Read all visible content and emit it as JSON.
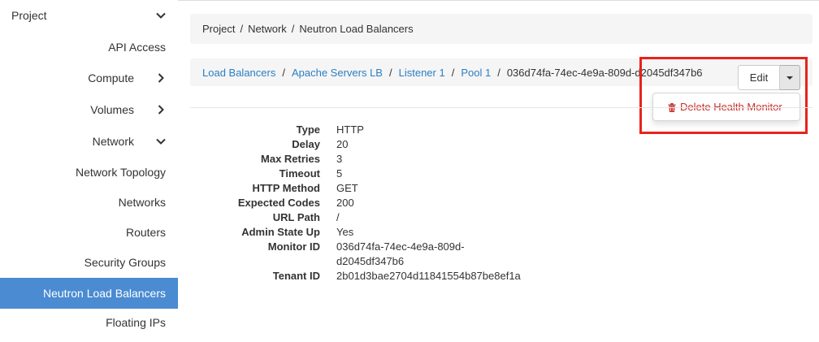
{
  "sidebar": {
    "items": [
      {
        "label": "Project",
        "level": 0,
        "chevron": "chevron-down"
      },
      {
        "label": "API Access",
        "level": 2,
        "chevron": ""
      },
      {
        "label": "Compute",
        "level": 1,
        "chevron": "chevron-right"
      },
      {
        "label": "Volumes",
        "level": 1,
        "chevron": "chevron-right"
      },
      {
        "label": "Network",
        "level": 1,
        "chevron": "chevron-down"
      },
      {
        "label": "Network Topology",
        "level": 2,
        "chevron": ""
      },
      {
        "label": "Networks",
        "level": 2,
        "chevron": ""
      },
      {
        "label": "Routers",
        "level": 2,
        "chevron": ""
      },
      {
        "label": "Security Groups",
        "level": 2,
        "chevron": ""
      },
      {
        "label": "Neutron Load Balancers",
        "level": 2,
        "chevron": "",
        "active": true
      },
      {
        "label": "Floating IPs",
        "level": 2,
        "chevron": ""
      }
    ]
  },
  "breadcrumb": {
    "items": [
      "Project",
      "Network",
      "Neutron Load Balancers"
    ],
    "separator": "/"
  },
  "page_header": {
    "links": [
      "Load Balancers",
      "Apache Servers LB",
      "Listener 1",
      "Pool 1"
    ],
    "current": "036d74fa-74ec-4e9a-809d-d2045df347b6",
    "separator": "/"
  },
  "actions": {
    "edit_label": "Edit",
    "dropdown_items": [
      "Delete Health Monitor"
    ]
  },
  "details": [
    {
      "label": "Type",
      "value": "HTTP"
    },
    {
      "label": "Delay",
      "value": "20"
    },
    {
      "label": "Max Retries",
      "value": "3"
    },
    {
      "label": "Timeout",
      "value": "5"
    },
    {
      "label": "HTTP Method",
      "value": "GET"
    },
    {
      "label": "Expected Codes",
      "value": "200"
    },
    {
      "label": "URL Path",
      "value": "/"
    },
    {
      "label": "Admin State Up",
      "value": "Yes"
    },
    {
      "label": "Monitor ID",
      "value": "036d74fa-74ec-4e9a-809d-d2045df347b6"
    },
    {
      "label": "Tenant ID",
      "value": "2b01d3bae2704d11841554b87be8ef1a"
    }
  ],
  "colors": {
    "accent": "#4a8bd2",
    "link": "#2a7ec4",
    "danger": "#c9302c",
    "highlight": "#e8231d"
  }
}
